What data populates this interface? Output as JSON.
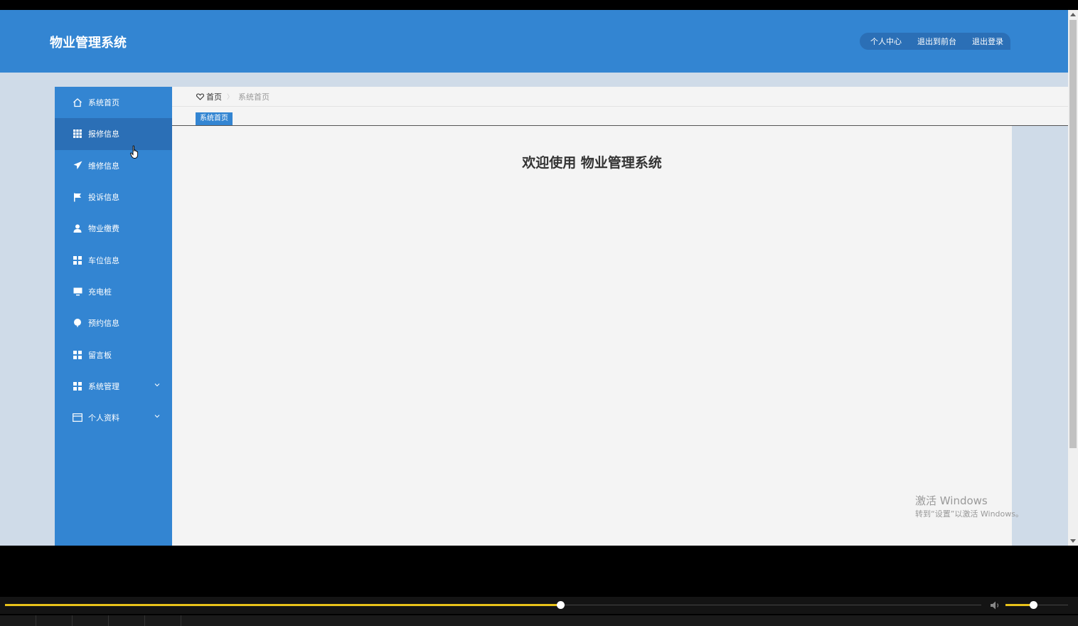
{
  "header": {
    "title": "物业管理系统",
    "actions": [
      "个人中心",
      "退出到前台",
      "退出登录"
    ]
  },
  "sidebar": {
    "items": [
      {
        "label": "系统首页",
        "icon": "home-icon"
      },
      {
        "label": "报修信息",
        "icon": "grid-icon",
        "active": true
      },
      {
        "label": "维修信息",
        "icon": "paper-plane-icon"
      },
      {
        "label": "投诉信息",
        "icon": "flag-icon"
      },
      {
        "label": "物业缴费",
        "icon": "user-icon"
      },
      {
        "label": "车位信息",
        "icon": "grid-four-icon"
      },
      {
        "label": "充电桩",
        "icon": "monitor-icon"
      },
      {
        "label": "预约信息",
        "icon": "balloon-icon"
      },
      {
        "label": "留言板",
        "icon": "grid-four-icon"
      },
      {
        "label": "系统管理",
        "icon": "grid-four-icon",
        "expandable": true
      },
      {
        "label": "个人资料",
        "icon": "card-icon",
        "expandable": true
      }
    ]
  },
  "breadcrumb": {
    "home": "首页",
    "separator": "〉",
    "current": "系统首页"
  },
  "tabs": [
    "系统首页"
  ],
  "main": {
    "welcome": "欢迎使用 物业管理系统"
  },
  "watermark": {
    "line1": "激活 Windows",
    "line2": "转到“设置”以激活 Windows。"
  },
  "player": {
    "progress": 0.569,
    "volume": 0.44
  },
  "colors": {
    "primary": "#3385d2",
    "active": "#2b6fb6",
    "background": "#cfdbe8",
    "accent": "#e8c21a"
  }
}
